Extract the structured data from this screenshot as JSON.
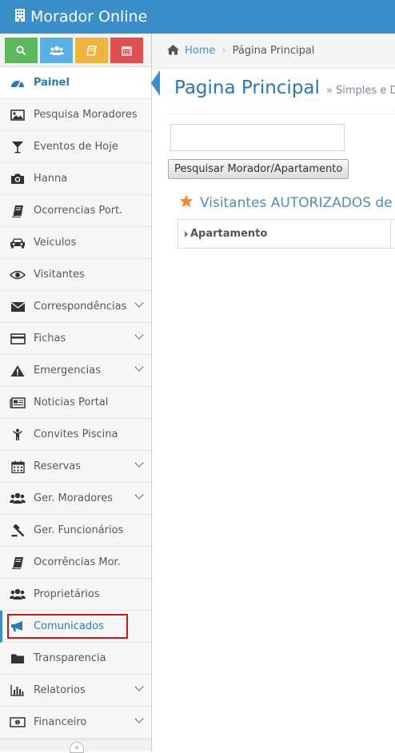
{
  "app": {
    "title": "Morador Online",
    "logo_icon": "building-icon"
  },
  "shortcuts": [
    {
      "name": "search-shortcut",
      "icon": "search-icon",
      "color": "#5cb85c"
    },
    {
      "name": "users-shortcut",
      "icon": "users-icon",
      "color": "#5bb0e6"
    },
    {
      "name": "book-shortcut",
      "icon": "book-icon",
      "color": "#f0b43c"
    },
    {
      "name": "calendar-shortcut",
      "icon": "calendar-icon",
      "color": "#e15050"
    }
  ],
  "sidebar": {
    "items": [
      {
        "label": "Painel",
        "icon": "dashboard-icon"
      },
      {
        "label": "Pesquisa Moradores",
        "icon": "picture-icon"
      },
      {
        "label": "Eventos de Hoje",
        "icon": "glass-icon"
      },
      {
        "label": "Hanna",
        "icon": "camera-icon"
      },
      {
        "label": "Ocorrencias Port.",
        "icon": "book-icon"
      },
      {
        "label": "Veiculos",
        "icon": "car-icon"
      },
      {
        "label": "Visitantes",
        "icon": "eye-icon"
      },
      {
        "label": "Correspondências",
        "icon": "envelope-icon"
      },
      {
        "label": "Fichas",
        "icon": "credit-card-icon"
      },
      {
        "label": "Emergencias",
        "icon": "warning-icon"
      },
      {
        "label": "Noticias Portal",
        "icon": "newspaper-icon"
      },
      {
        "label": "Convites Piscina",
        "icon": "child-icon"
      },
      {
        "label": "Reservas",
        "icon": "calendar-icon"
      },
      {
        "label": "Ger. Moradores",
        "icon": "users-icon"
      },
      {
        "label": "Ger. Funcionários",
        "icon": "gavel-icon"
      },
      {
        "label": "Ocorrências Mor.",
        "icon": "book-icon"
      },
      {
        "label": "Proprietários",
        "icon": "users-icon"
      },
      {
        "label": "Comunicados",
        "icon": "bullhorn-icon"
      },
      {
        "label": "Transparencia",
        "icon": "folder-icon"
      },
      {
        "label": "Relatorios",
        "icon": "bar-chart-icon"
      },
      {
        "label": "Financeiro",
        "icon": "money-icon"
      }
    ]
  },
  "breadcrumb": {
    "home": "Home",
    "current": "Página Principal"
  },
  "page": {
    "title": "Pagina Principal",
    "subtitle": "Simples e Dir"
  },
  "search": {
    "value": "",
    "button_label": "Pesquisar Morador/Apartamento"
  },
  "widget": {
    "title": "Visitantes AUTORIZADOS de H",
    "table_header": "Apartamento"
  }
}
